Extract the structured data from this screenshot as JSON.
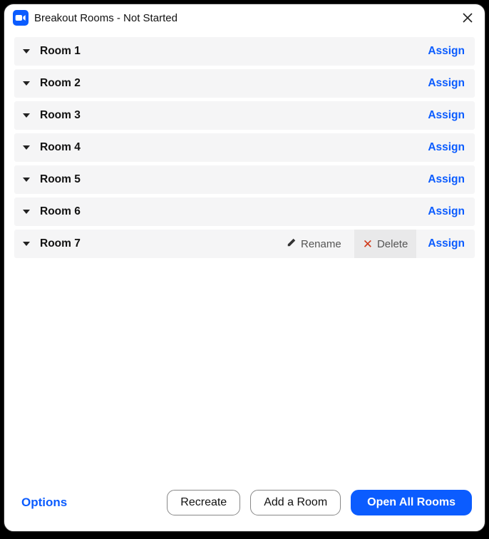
{
  "title": "Breakout Rooms - Not Started",
  "assign_label": "Assign",
  "rename_label": "Rename",
  "delete_label": "Delete",
  "rooms": [
    {
      "name": "Room 1",
      "hover": false
    },
    {
      "name": "Room 2",
      "hover": false
    },
    {
      "name": "Room 3",
      "hover": false
    },
    {
      "name": "Room 4",
      "hover": false
    },
    {
      "name": "Room 5",
      "hover": false
    },
    {
      "name": "Room 6",
      "hover": false
    },
    {
      "name": "Room 7",
      "hover": true
    }
  ],
  "footer": {
    "options": "Options",
    "recreate": "Recreate",
    "add_room": "Add a Room",
    "open_all": "Open All Rooms"
  }
}
